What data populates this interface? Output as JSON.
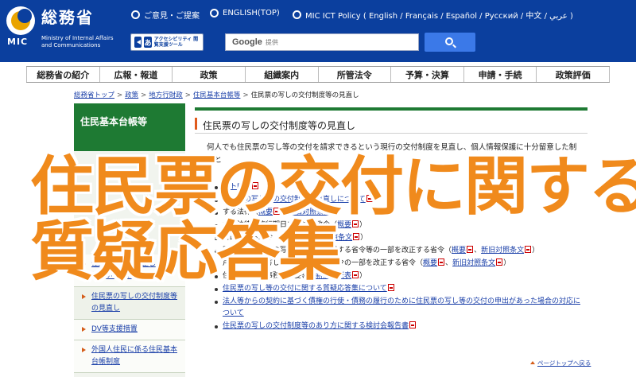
{
  "header": {
    "logo_name": "総務省",
    "logo_mic": "MIC",
    "logo_en": "Ministry of Internal Affairs and Communications",
    "links": [
      {
        "label": "ご意見・ご提案"
      },
      {
        "label": "ENGLISH(TOP)"
      },
      {
        "label": "MIC ICT Policy ( English / Français / Español / Русский / 中文 / عربي )"
      }
    ],
    "access_label": "アクセシビリティ 閲覧支援ツール",
    "search_brand": "Google",
    "search_placeholder": "提供"
  },
  "nav": {
    "items": [
      "総務省の紹介",
      "広報・報道",
      "政策",
      "組織案内",
      "所管法令",
      "予算・決算",
      "申請・手続",
      "政策評価"
    ]
  },
  "breadcrumb": {
    "items": [
      "総務省トップ",
      "政策",
      "地方行財政",
      "住民基本台帳等"
    ],
    "current": "住民票の写しの交付制度等の見直し"
  },
  "sidebar": {
    "heading": "住民基本台帳等",
    "items": [
      "住所の異動届は正しく行われていますか？",
      "住民票の写しの交付制度等の見直し",
      "DV等支援措置",
      "外国人住民に係る住民基本台帳制度"
    ]
  },
  "main": {
    "title": "住民票の写しの交付制度等の見直し",
    "intro_line1": "何人でも住民票の写し等の交付を請求できるという現行の交付制度を見直し、個人情報保護に十分留意した制度と",
    "intro_line2": "",
    "items": [
      {
        "text": "ントPDF",
        "links": []
      },
      {
        "text": "住民票の写し等の交付制度の見直しについて",
        "links": []
      },
      {
        "text": "する法律",
        "links": [
          "概要",
          "新旧対照条文"
        ]
      },
      {
        "text": "する法律の施行期日を定める政令",
        "links": [
          "概要"
        ]
      },
      {
        "text": "を改正する政令",
        "links": [
          "概要",
          "新旧対照条文"
        ]
      },
      {
        "text": "閲覧及び住民票の写し等の交付に関する省令等の一部を改正する省令",
        "links": [
          "概要",
          "新旧対照条文"
        ]
      },
      {
        "text": "戸籍の附票の写しの交付に関する省令の一部を改正する省令",
        "links": [
          "概要",
          "新旧対照条文"
        ]
      },
      {
        "text": "住民基本台帳事務処理要領",
        "links": [
          "新旧対照表"
        ]
      },
      {
        "text": "住民票の写し等の交付に関する質疑応答集について",
        "links": []
      },
      {
        "text": "法人等からの契約に基づく債権の行使・債務の履行のために住民票の写し等の交付の申出があった場合の対応について",
        "links": []
      },
      {
        "text": "住民票の写しの交付制度等のあり方に関する検討会報告書",
        "links": []
      }
    ],
    "page_top": "ページトップへ戻る"
  },
  "overlay": {
    "line1": "住民票の交付に関する",
    "line2": "質疑応答集"
  },
  "colors": {
    "header_bg": "#0b3f9e",
    "sidebar_head": "#1e7a33",
    "overlay_text": "#f08a1c",
    "link": "#1a3fa8"
  }
}
